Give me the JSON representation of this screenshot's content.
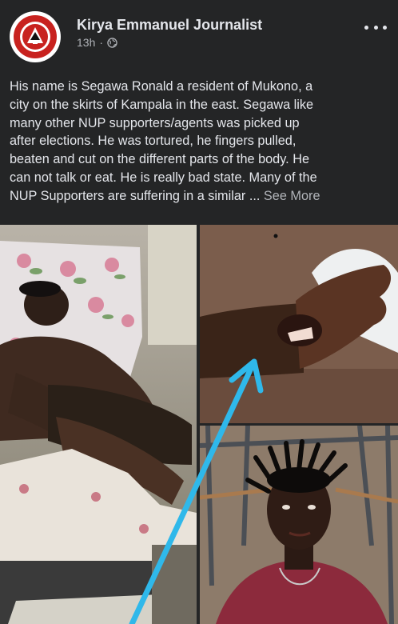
{
  "post": {
    "author": "Kirya Emmanuel Journalist",
    "time": "13h",
    "audience_icon": "globe-icon",
    "text_lines": [
      "His name is Segawa Ronald a resident of Mukono, a",
      "city on the skirts of Kampala in the east. Segawa like",
      "many other NUP supporters/agents  was picked up",
      "after elections. He was tortured, he fingers pulled,",
      "beaten and cut on the different parts of the body. He",
      "can not talk or eat. He is really bad state. Many of the",
      "NUP Supporters are suffering in a similar ... "
    ],
    "see_more": "See More"
  },
  "colors": {
    "background": "#242526",
    "text": "#e4e6eb",
    "secondary_text": "#b0b3b8",
    "arrow": "#2fb8ea",
    "logo_red": "#c8221f"
  }
}
